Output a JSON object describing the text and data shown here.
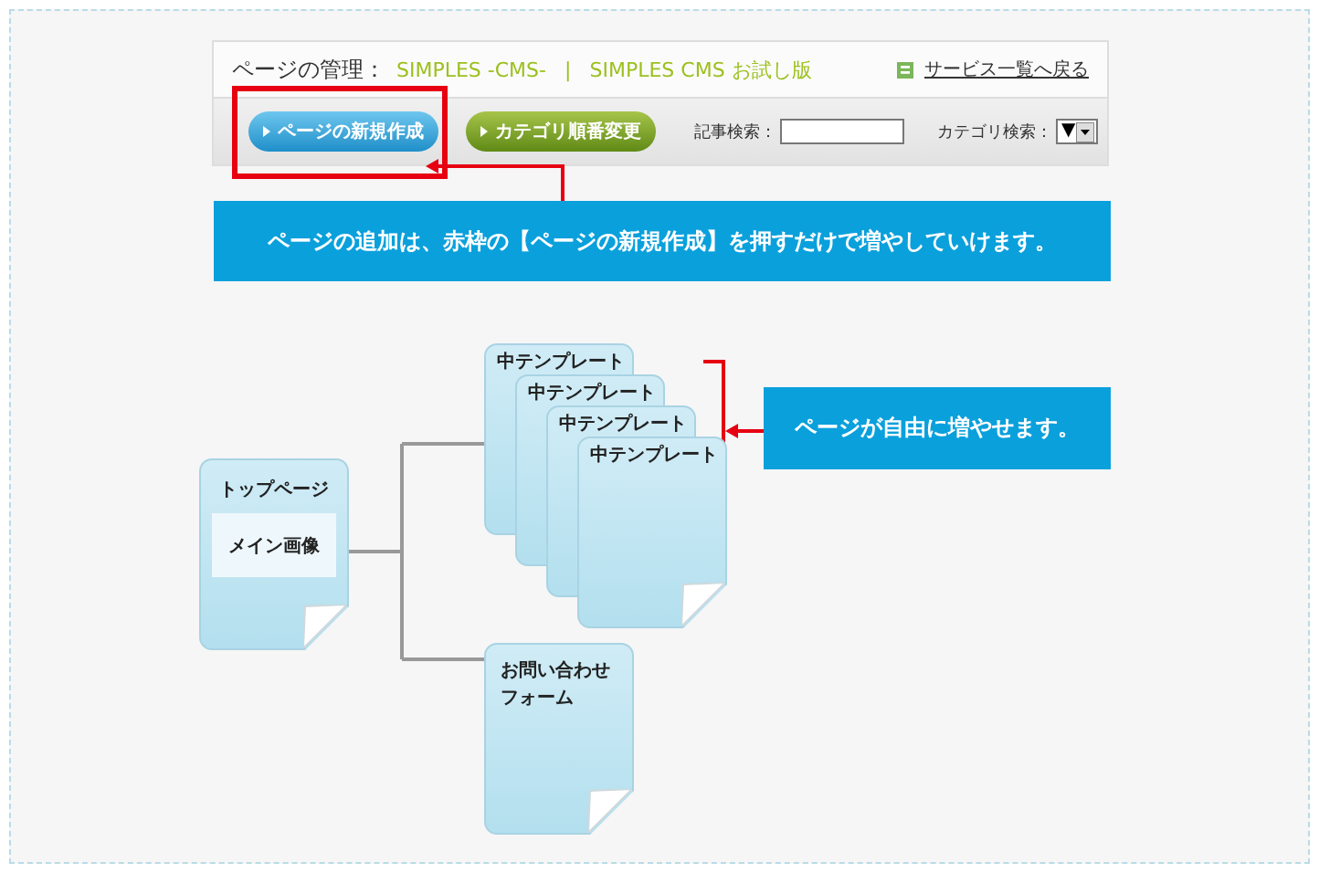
{
  "header": {
    "title": "ページの管理：",
    "site_names": [
      "SIMPLES -CMS-",
      "SIMPLES CMS お試し版"
    ],
    "separator": "|",
    "back_link": "サービス一覧へ戻る"
  },
  "toolbar": {
    "buttons": [
      {
        "label": "ページの新規作成",
        "kind": "blue",
        "highlighted": true
      },
      {
        "label": "カテゴリ順番変更",
        "kind": "green",
        "highlighted": false
      }
    ],
    "article_search": {
      "label": "記事検索："
    },
    "category_search": {
      "label": "カテゴリ検索：",
      "value": "▼"
    }
  },
  "callouts": [
    "ページの追加は、赤枠の【ページの新規作成】を押すだけで増やしていけます。",
    "ページが自由に増やせます。"
  ],
  "diagram": {
    "top_page": {
      "title": "トップページ",
      "inner": "メイン画像"
    },
    "templates": [
      "中テンプレート",
      "中テンプレート",
      "中テンプレート",
      "中テンプレート"
    ],
    "contact": {
      "lines": [
        "お問い合わせ",
        "フォーム"
      ]
    }
  }
}
